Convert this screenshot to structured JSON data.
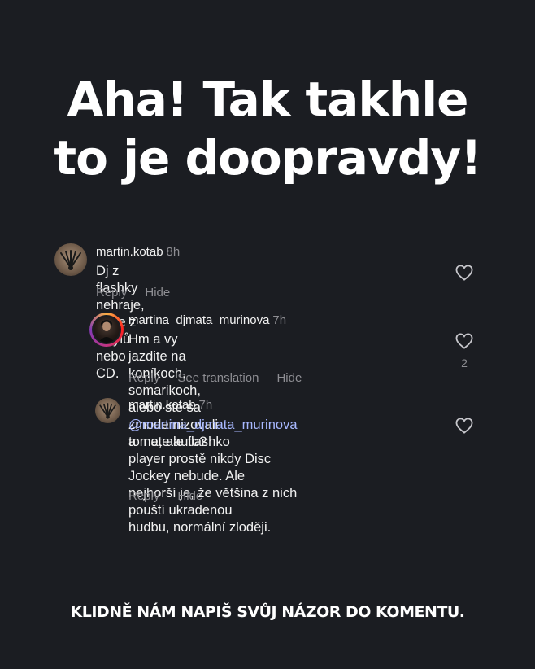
{
  "headline": {
    "line1": "Aha! Tak takhle",
    "line2": "to je doopravdy!"
  },
  "comments": [
    {
      "username": "martin.kotab",
      "time": "8h",
      "text": "Dj z flashky nehraje, hraje z vinylů nebo CD.",
      "actions": [
        "Reply",
        "Hide"
      ]
    },
    {
      "username": "martina_djmata_murinova",
      "time": "7h",
      "text_line1": "Hm a vy jazdite na koníkoch, somarikoch,",
      "text_line2": "alebo ste sa zmodernizovali a mate auto?",
      "actions": [
        "Reply",
        "See translation",
        "Hide"
      ],
      "likes": "2"
    },
    {
      "username": "martin.kotab",
      "time": "7h",
      "mention": "@martina_djmata_murinova",
      "text_rest1": " to ne, ale flashko",
      "text_line2": "player prostě nikdy Disc Jockey nebude. Ale",
      "text_line3": "nejhorší je, že většina z nich pouští ukradenou",
      "text_line4": "hudbu, normální zloději.",
      "actions": [
        "Reply",
        "Hide"
      ]
    }
  ],
  "cta": "KLIDNĚ NÁM NAPIŠ SVŮJ NÁZOR DO KOMENTU.",
  "icons": {
    "heart": "heart-outline-icon",
    "avatar_kotab": "dj-avatar-icon",
    "avatar_murinova": "profile-avatar"
  },
  "colors": {
    "background": "#1b1d22",
    "text": "#f2f2f2",
    "muted": "#8e8e93",
    "mention": "#a8b8ff"
  }
}
